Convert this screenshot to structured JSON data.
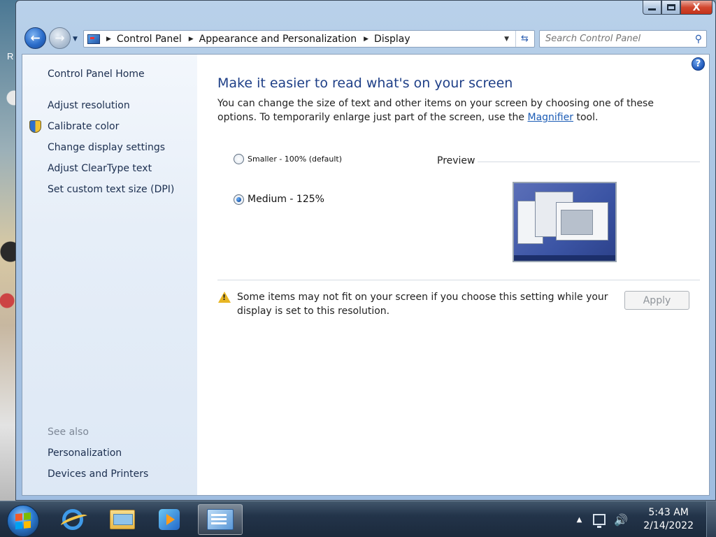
{
  "desktop": {
    "edge_letter": "R"
  },
  "window": {
    "caption_buttons": {
      "minimize": "",
      "maximize": "",
      "close": "X"
    }
  },
  "address": {
    "breadcrumbs": [
      "Control Panel",
      "Appearance and Personalization",
      "Display"
    ]
  },
  "search": {
    "placeholder": "Search Control Panel"
  },
  "sidebar": {
    "home": "Control Panel Home",
    "links": [
      "Adjust resolution",
      "Calibrate color",
      "Change display settings",
      "Adjust ClearType text",
      "Set custom text size (DPI)"
    ],
    "see_also_heading": "See also",
    "see_also": [
      "Personalization",
      "Devices and Printers"
    ]
  },
  "main": {
    "help": "?",
    "title": "Make it easier to read what's on your screen",
    "intro_before_link": "You can change the size of text and other items on your screen by choosing one of these options. To temporarily enlarge just part of the screen, use the ",
    "intro_link": "Magnifier",
    "intro_after_link": " tool.",
    "options": [
      {
        "label": "Smaller - 100% (default)",
        "selected": false
      },
      {
        "label": "Medium - 125%",
        "selected": true
      }
    ],
    "preview_label": "Preview",
    "warning_mark": "!",
    "warning": "Some items may not fit on your screen if you choose this setting while your display is set to this resolution.",
    "apply_label": "Apply"
  },
  "taskbar": {
    "pinned": [
      "internet-explorer-icon",
      "windows-explorer-icon",
      "media-player-icon",
      "control-panel-icon"
    ],
    "active_index": 3,
    "tray_arrow": "▲",
    "volume_glyph": "🔊",
    "clock": {
      "time": "5:43 AM",
      "date": "2/14/2022"
    }
  },
  "colors": {
    "title_blue": "#1e3f87",
    "link_blue": "#1a5bb5",
    "sidebar_text": "#1b2e4f",
    "close_red": "#d2472f"
  }
}
